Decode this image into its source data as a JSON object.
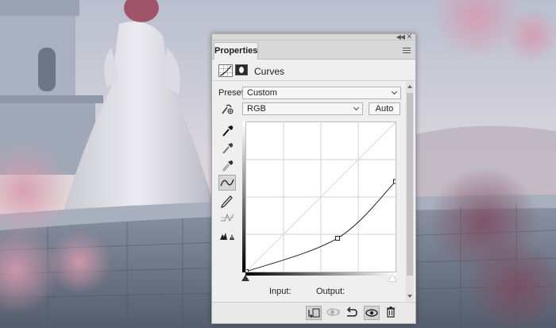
{
  "panel": {
    "tab_label": "Properties",
    "adjustment_title": "Curves",
    "preset_label": "Preset:",
    "preset_value": "Custom",
    "channel_value": "RGB",
    "auto_label": "Auto",
    "input_label": "Input:",
    "output_label": "Output:"
  },
  "tools": [
    "on-image-adjust-icon",
    "black-point-eyedropper-icon",
    "gray-point-eyedropper-icon",
    "white-point-eyedropper-icon",
    "curve-points-icon",
    "pencil-draw-icon",
    "smooth-curve-icon",
    "clipping-warning-icon"
  ],
  "curve": {
    "input_range": [
      0,
      255
    ],
    "output_range": [
      0,
      255
    ],
    "points": [
      [
        0,
        0
      ],
      [
        156,
        57
      ],
      [
        255,
        154
      ]
    ]
  },
  "colors": {
    "panel_bg": "#efefef",
    "curve_line": "#222222"
  }
}
